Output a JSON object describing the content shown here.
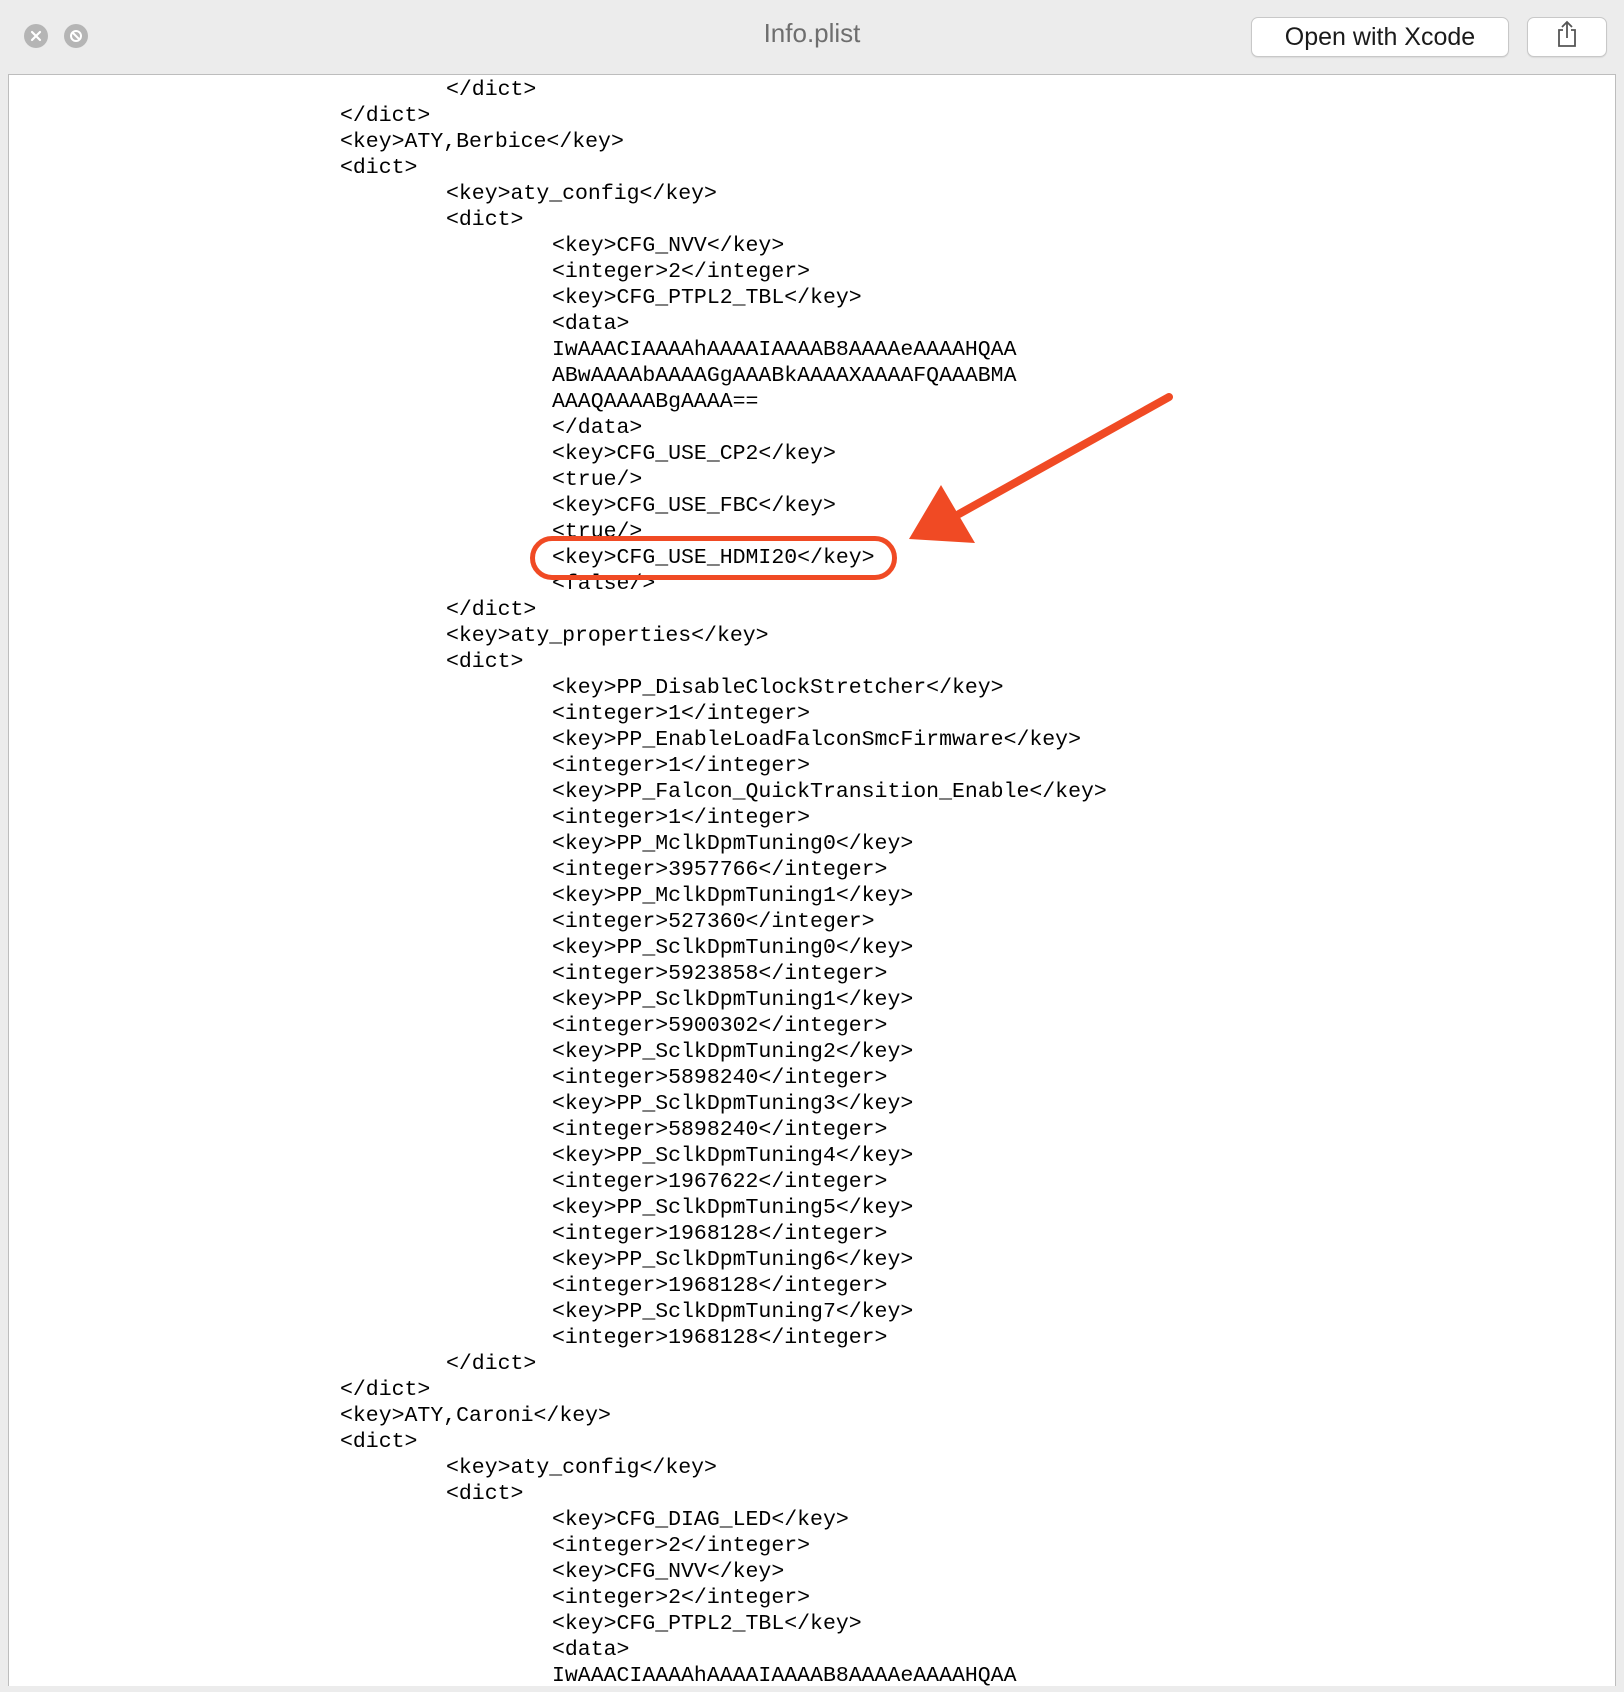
{
  "window": {
    "title": "Info.plist",
    "open_button_label": "Open with Xcode",
    "close_icon": "close-icon",
    "disabled_icon": "minimize-icon",
    "share_icon": "share-icon"
  },
  "annotation": {
    "color": "#f04a24",
    "highlighted_text": "<key>CFG_USE_HDMI20</key>"
  },
  "lines": [
    {
      "indent": 2,
      "text": "</dict>"
    },
    {
      "indent": 1,
      "text": "</dict>"
    },
    {
      "indent": 1,
      "text": "<key>ATY,Berbice</key>"
    },
    {
      "indent": 1,
      "text": "<dict>"
    },
    {
      "indent": 2,
      "text": "<key>aty_config</key>"
    },
    {
      "indent": 2,
      "text": "<dict>"
    },
    {
      "indent": 3,
      "text": "<key>CFG_NVV</key>"
    },
    {
      "indent": 3,
      "text": "<integer>2</integer>"
    },
    {
      "indent": 3,
      "text": "<key>CFG_PTPL2_TBL</key>"
    },
    {
      "indent": 3,
      "text": "<data>"
    },
    {
      "indent": 3,
      "text": "IwAAACIAAAAhAAAAIAAAAB8AAAAeAAAAHQAA"
    },
    {
      "indent": 3,
      "text": "ABwAAAAbAAAAGgAAABkAAAAXAAAAFQAAABMA"
    },
    {
      "indent": 3,
      "text": "AAAQAAAABgAAAA=="
    },
    {
      "indent": 3,
      "text": "</data>"
    },
    {
      "indent": 3,
      "text": "<key>CFG_USE_CP2</key>"
    },
    {
      "indent": 3,
      "text": "<true/>"
    },
    {
      "indent": 3,
      "text": "<key>CFG_USE_FBC</key>"
    },
    {
      "indent": 3,
      "text": "<true/>"
    },
    {
      "indent": 3,
      "text": "<key>CFG_USE_HDMI20</key>"
    },
    {
      "indent": 3,
      "text": "<false/>"
    },
    {
      "indent": 2,
      "text": "</dict>"
    },
    {
      "indent": 2,
      "text": "<key>aty_properties</key>"
    },
    {
      "indent": 2,
      "text": "<dict>"
    },
    {
      "indent": 3,
      "text": "<key>PP_DisableClockStretcher</key>"
    },
    {
      "indent": 3,
      "text": "<integer>1</integer>"
    },
    {
      "indent": 3,
      "text": "<key>PP_EnableLoadFalconSmcFirmware</key>"
    },
    {
      "indent": 3,
      "text": "<integer>1</integer>"
    },
    {
      "indent": 3,
      "text": "<key>PP_Falcon_QuickTransition_Enable</key>"
    },
    {
      "indent": 3,
      "text": "<integer>1</integer>"
    },
    {
      "indent": 3,
      "text": "<key>PP_MclkDpmTuning0</key>"
    },
    {
      "indent": 3,
      "text": "<integer>3957766</integer>"
    },
    {
      "indent": 3,
      "text": "<key>PP_MclkDpmTuning1</key>"
    },
    {
      "indent": 3,
      "text": "<integer>527360</integer>"
    },
    {
      "indent": 3,
      "text": "<key>PP_SclkDpmTuning0</key>"
    },
    {
      "indent": 3,
      "text": "<integer>5923858</integer>"
    },
    {
      "indent": 3,
      "text": "<key>PP_SclkDpmTuning1</key>"
    },
    {
      "indent": 3,
      "text": "<integer>5900302</integer>"
    },
    {
      "indent": 3,
      "text": "<key>PP_SclkDpmTuning2</key>"
    },
    {
      "indent": 3,
      "text": "<integer>5898240</integer>"
    },
    {
      "indent": 3,
      "text": "<key>PP_SclkDpmTuning3</key>"
    },
    {
      "indent": 3,
      "text": "<integer>5898240</integer>"
    },
    {
      "indent": 3,
      "text": "<key>PP_SclkDpmTuning4</key>"
    },
    {
      "indent": 3,
      "text": "<integer>1967622</integer>"
    },
    {
      "indent": 3,
      "text": "<key>PP_SclkDpmTuning5</key>"
    },
    {
      "indent": 3,
      "text": "<integer>1968128</integer>"
    },
    {
      "indent": 3,
      "text": "<key>PP_SclkDpmTuning6</key>"
    },
    {
      "indent": 3,
      "text": "<integer>1968128</integer>"
    },
    {
      "indent": 3,
      "text": "<key>PP_SclkDpmTuning7</key>"
    },
    {
      "indent": 3,
      "text": "<integer>1968128</integer>"
    },
    {
      "indent": 2,
      "text": "</dict>"
    },
    {
      "indent": 1,
      "text": "</dict>"
    },
    {
      "indent": 1,
      "text": "<key>ATY,Caroni</key>"
    },
    {
      "indent": 1,
      "text": "<dict>"
    },
    {
      "indent": 2,
      "text": "<key>aty_config</key>"
    },
    {
      "indent": 2,
      "text": "<dict>"
    },
    {
      "indent": 3,
      "text": "<key>CFG_DIAG_LED</key>"
    },
    {
      "indent": 3,
      "text": "<integer>2</integer>"
    },
    {
      "indent": 3,
      "text": "<key>CFG_NVV</key>"
    },
    {
      "indent": 3,
      "text": "<integer>2</integer>"
    },
    {
      "indent": 3,
      "text": "<key>CFG_PTPL2_TBL</key>"
    },
    {
      "indent": 3,
      "text": "<data>"
    },
    {
      "indent": 3,
      "text": "IwAAACIAAAAhAAAAIAAAAB8AAAAeAAAAHQAA"
    }
  ]
}
